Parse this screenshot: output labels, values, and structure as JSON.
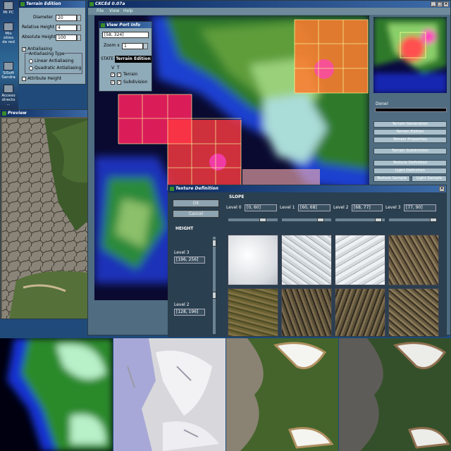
{
  "desktop": {
    "icons": [
      {
        "label": "Mi PC",
        "icon": "computer-icon"
      },
      {
        "label": "Mis sitios de red",
        "icon": "network-icon"
      },
      {
        "label": "SiSoft Sandra",
        "icon": "sandra-icon"
      },
      {
        "label": "Acceso directo ...",
        "icon": "shortcut-icon"
      }
    ]
  },
  "terrain_edition": {
    "title": "Terrain Edition",
    "diameter_label": "Diameter",
    "diameter_value": "20",
    "relative_height_label": "Relative Height",
    "relative_height_value": "4",
    "absolute_height_label": "Absolute Height",
    "absolute_height_value": "100",
    "antialiasing_label": "Antialiasing",
    "antialiasing_checked": true,
    "antialiasing_type_label": "Antialiasing Type",
    "linear_label": "Linear Antialiasing",
    "quadratic_label": "Quadratic Antialiasing",
    "attribute_height_label": "Attribute Height"
  },
  "preview": {
    "title": "Preview"
  },
  "main_window": {
    "title": "CKCEd 0.07a",
    "menu": [
      "File",
      "View",
      "Help"
    ],
    "done_label": "Done!"
  },
  "view_port_info": {
    "title": "View Port Info",
    "coords": "[58, 324]",
    "zoom_label": "Zoom x",
    "zoom_value": "1",
    "state_label": "STATE",
    "state_value": "Terrain Edition",
    "v_label": "V",
    "t_label": "T",
    "terrain_label": "Terrain",
    "subdivision_label": "Subdivision"
  },
  "right_panel": {
    "buttons": [
      "Terrain Generation",
      "Terrain Edition",
      "Terrain Properties",
      "Terrain Subdivision",
      "Texture Definition",
      "Light Definition"
    ],
    "texture_sample_label": "Texture Sample",
    "light_sample_label": "Light Sample"
  },
  "texture_definition": {
    "title": "Texture Definition",
    "ok_label": "OK",
    "cancel_label": "Cancel",
    "slope_label": "SLOPE",
    "height_label": "HEIGHT",
    "slope_levels": [
      {
        "label": "Level 0",
        "value": "[0, 60]"
      },
      {
        "label": "Level 1",
        "value": "[60, 68]"
      },
      {
        "label": "Level 2",
        "value": "[68, 77]"
      },
      {
        "label": "Level 3",
        "value": "[77, 90]"
      }
    ],
    "height_levels": [
      {
        "label": "Level 3",
        "value": "[196, 256]"
      },
      {
        "label": "Level 2",
        "value": "[128, 196]"
      }
    ]
  },
  "colors": {
    "title_bar": "#0c2a60",
    "panel": "#8faab8",
    "texture_window": "#2a3f4f"
  }
}
